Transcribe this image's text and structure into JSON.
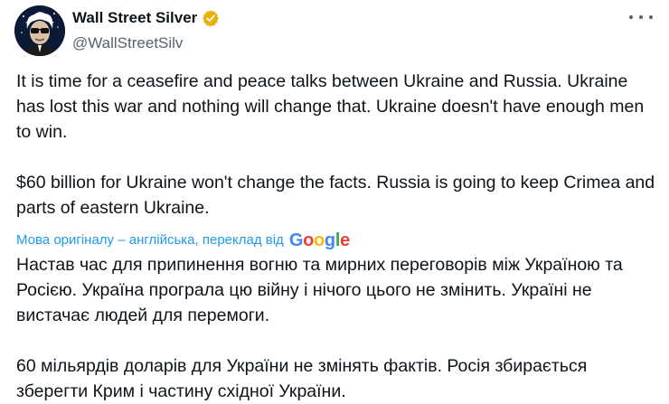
{
  "tweet": {
    "author": {
      "display_name": "Wall Street Silver",
      "handle": "@WallStreetSilv",
      "verified_icon": "verified-badge-gold"
    },
    "more_icon": "more-options-icon",
    "text_paragraphs": [
      "It is time for a ceasefire and peace talks between Ukraine and Russia. Ukraine has lost this war and nothing will change that. Ukraine doesn't have enough men to win.",
      "$60 billion for Ukraine won't change the facts. Russia is going to keep Crimea and parts of eastern Ukraine."
    ],
    "translation": {
      "label": "Мова оригіналу – англійська, переклад від",
      "provider": "Google",
      "paragraphs": [
        "Настав час для припинення вогню та мирних переговорів між Україною та Росією. Україна програла цю війну і нічого цього не змінить. Україні не вистачає людей для перемоги.",
        "60 мільярдів доларів для України не змінять фактів. Росія збирається зберегти Крим і частину східної України."
      ]
    },
    "colors": {
      "link": "#1d9bf0",
      "secondary_text": "#536471",
      "primary_text": "#0f1419",
      "verified": "#e8b000"
    }
  }
}
